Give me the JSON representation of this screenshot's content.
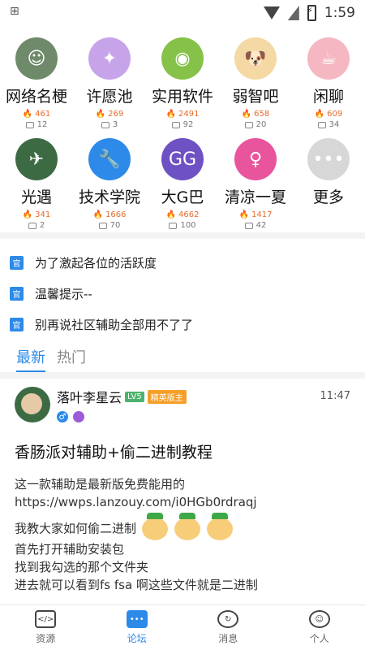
{
  "status": {
    "time": "1:59"
  },
  "categories": [
    {
      "name": "网络名梗",
      "hot": "461",
      "comments": "12",
      "icon": "meme-avatar-icon",
      "color": "#6f8a6a"
    },
    {
      "name": "许愿池",
      "hot": "269",
      "comments": "3",
      "icon": "wish-pool-icon",
      "color": "#c7a4e9"
    },
    {
      "name": "实用软件",
      "hot": "2491",
      "comments": "92",
      "icon": "android-icon",
      "color": "#86c24a"
    },
    {
      "name": "弱智吧",
      "hot": "658",
      "comments": "20",
      "icon": "dog-meme-icon",
      "color": "#f4d9a5"
    },
    {
      "name": "闲聊",
      "hot": "609",
      "comments": "34",
      "icon": "cup-icon",
      "color": "#f5b7c2"
    },
    {
      "name": "光遇",
      "hot": "341",
      "comments": "2",
      "icon": "sky-avatar-icon",
      "color": "#3c6b43"
    },
    {
      "name": "技术学院",
      "hot": "1666",
      "comments": "70",
      "icon": "wrench-icon",
      "color": "#2d8ae8"
    },
    {
      "name": "大G巴",
      "hot": "4662",
      "comments": "100",
      "icon": "gg-icon",
      "color": "#6e52c4"
    },
    {
      "name": "清凉一夏",
      "hot": "1417",
      "comments": "42",
      "icon": "girl-icon",
      "color": "#e8559c"
    },
    {
      "name": "更多",
      "hot": "",
      "comments": "",
      "icon": "more-dots-icon",
      "color": "#d7d7d7"
    }
  ],
  "notices": [
    {
      "badge": "官",
      "text": "为了激起各位的活跃度"
    },
    {
      "badge": "官",
      "text": "温馨提示--"
    },
    {
      "badge": "官",
      "text": "别再说社区辅助全部用不了了"
    }
  ],
  "tabs": [
    {
      "label": "最新"
    },
    {
      "label": "热门"
    }
  ],
  "post": {
    "author": "落叶李星云",
    "level": "LV5",
    "role": "精英版主",
    "time": "11:47",
    "title": "香肠派对辅助+偷二进制教程",
    "lines": [
      "这一款辅助是最新版免费能用的",
      "https://wwps.lanzouy.com/i0HGb0rdraqj",
      "我教大家如何偷二进制",
      "首先打开辅助安装包",
      "找到我勾选的那个文件夹",
      "进去就可以看到fs fsa 啊这些文件就是二进制"
    ]
  },
  "bottom_nav": [
    {
      "label": "资源",
      "icon": "code-icon"
    },
    {
      "label": "论坛",
      "icon": "forum-icon"
    },
    {
      "label": "消息",
      "icon": "message-icon"
    },
    {
      "label": "个人",
      "icon": "profile-icon"
    }
  ]
}
